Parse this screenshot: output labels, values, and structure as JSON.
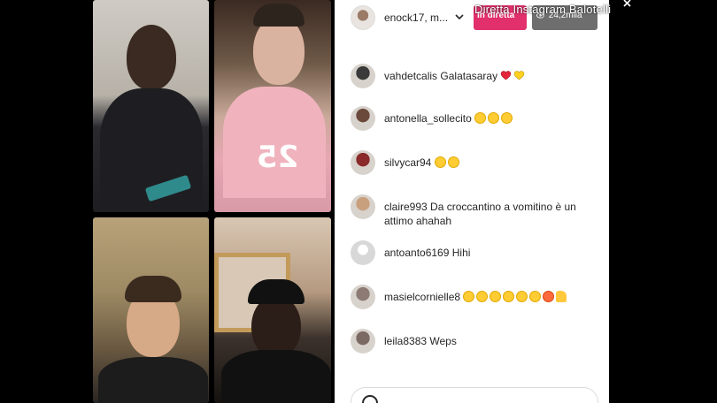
{
  "overlay": {
    "title": "Diretta Instagram Balotelli"
  },
  "header": {
    "username": "enock17, m...",
    "live_label": "In diretta",
    "viewers_label": "24,2mila"
  },
  "comments": [
    {
      "user": "vahdetcalis",
      "message": "Galatasaray",
      "avatar_color": "#3a3a3a",
      "emoji": [
        "heart-red",
        "heart-yellow"
      ]
    },
    {
      "user": "antonella_sollecito",
      "message": "",
      "avatar_color": "#6b4a3c",
      "emoji": [
        "laugh",
        "laugh",
        "laugh"
      ]
    },
    {
      "user": "silvycar94",
      "message": "",
      "avatar_color": "#8a2a2a",
      "emoji": [
        "rofl",
        "rofl"
      ]
    },
    {
      "user": "claire993",
      "message": "Da croccantino a vomitino è un attimo ahahah",
      "avatar_color": "#c9a07e",
      "emoji": []
    },
    {
      "user": "antoanto6169",
      "message": "Hihi",
      "avatar_color": "#e6e6e6",
      "emoji": []
    },
    {
      "user": "masielcornielle8",
      "message": "",
      "avatar_color": "#8d7a74",
      "emoji": [
        "rofl",
        "rofl",
        "rofl",
        "laugh",
        "rofl",
        "rofl",
        "angry",
        "thumbs-up"
      ]
    },
    {
      "user": "leila8383",
      "message": "Weps",
      "avatar_color": "#7b6a63",
      "emoji": []
    }
  ],
  "colors": {
    "live": "#e1306c",
    "viewers": "#6e6e6e",
    "panel_bg": "#ffffff",
    "text": "#262626"
  }
}
